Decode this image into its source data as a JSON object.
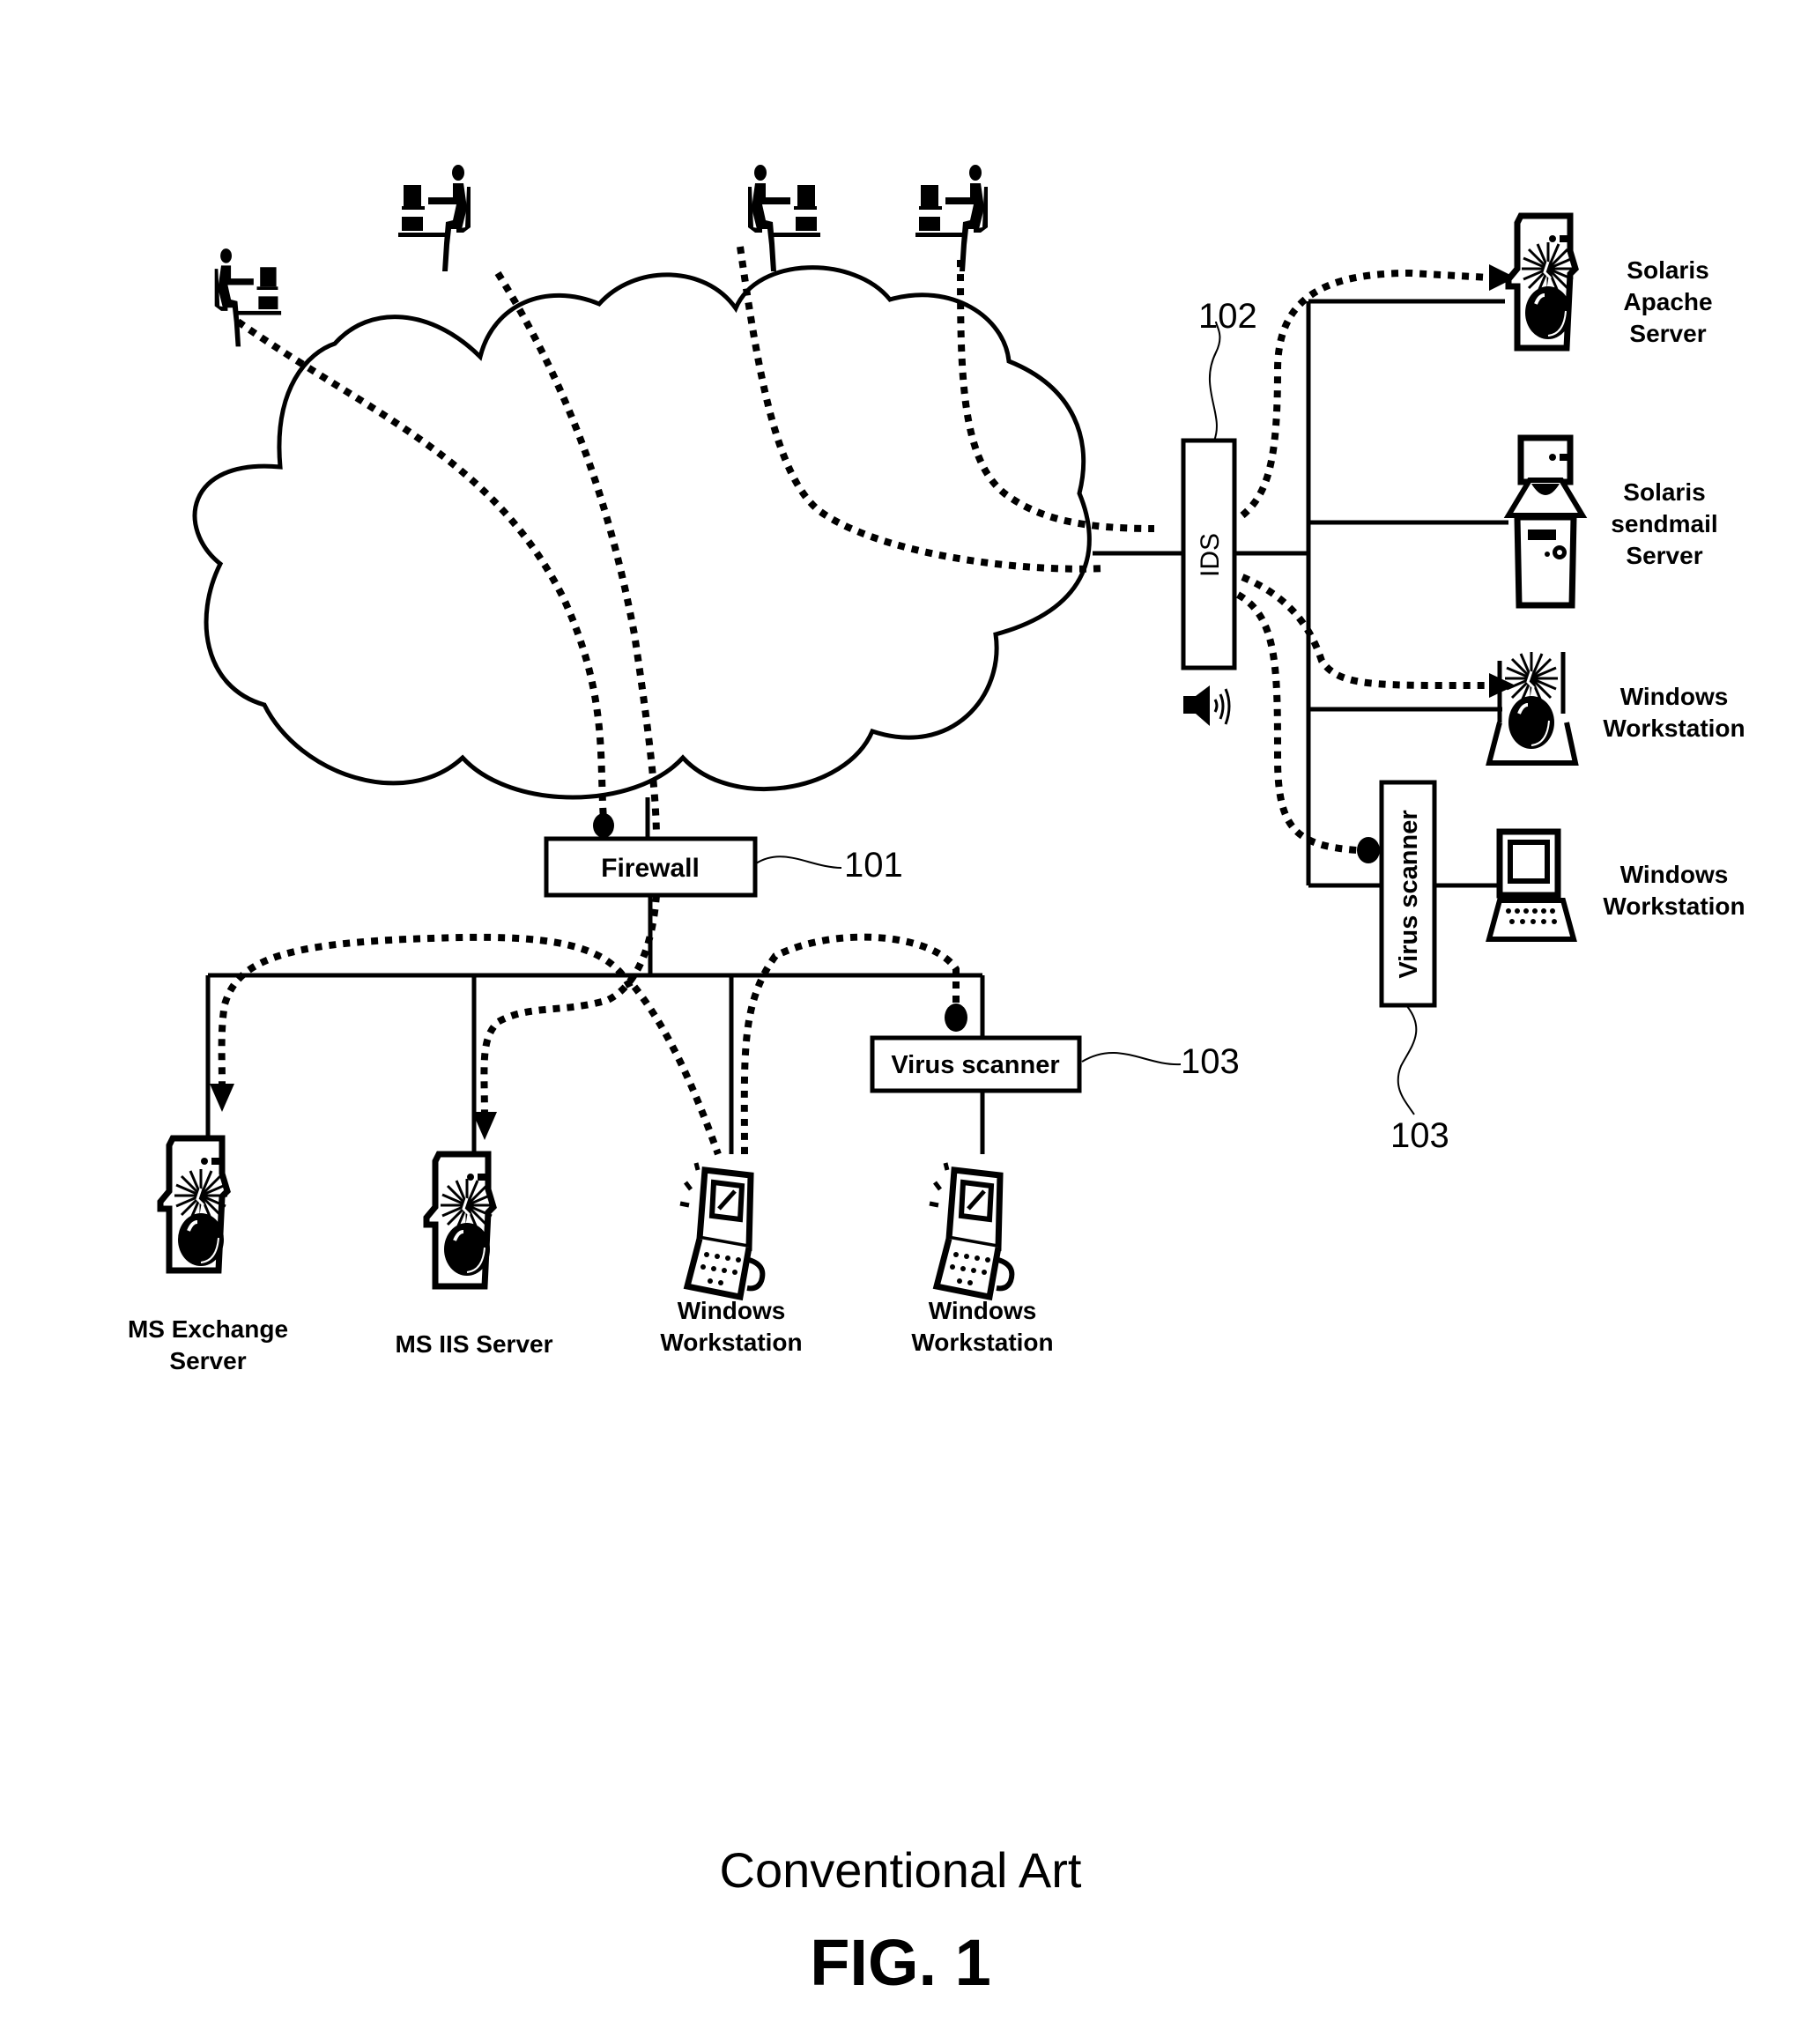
{
  "figure": {
    "caption": "Conventional Art",
    "label": "FIG. 1"
  },
  "network": {
    "cloud_label": "",
    "firewall": {
      "label": "Firewall",
      "ref": "101"
    },
    "ids": {
      "label": "IDS",
      "ref": "102"
    },
    "virus_scanner_lan": {
      "label": "Virus scanner",
      "ref": "103"
    },
    "virus_scanner_dmz": {
      "label": "Virus scanner",
      "ref": "103"
    }
  },
  "users": [
    {
      "id": "user-1",
      "icon": "user-at-computer-icon"
    },
    {
      "id": "user-2",
      "icon": "user-at-computer-icon"
    },
    {
      "id": "user-3",
      "icon": "user-at-computer-icon"
    },
    {
      "id": "user-4",
      "icon": "user-at-computer-icon"
    }
  ],
  "right_nodes": [
    {
      "line1": "Solaris",
      "line2": "Apache",
      "line3": "Server",
      "icon": "server-bomb-icon",
      "compromised": true
    },
    {
      "line1": "Solaris",
      "line2": "sendmail",
      "line3": "Server",
      "icon": "server-shield-icon",
      "compromised": false
    },
    {
      "line1": "Windows",
      "line2": "Workstation",
      "icon": "workstation-bomb-icon",
      "compromised": true
    },
    {
      "line1": "Windows",
      "line2": "Workstation",
      "icon": "desktop-computer-icon",
      "compromised": false
    }
  ],
  "bottom_nodes": [
    {
      "line1": "MS Exchange",
      "line2": "Server",
      "icon": "server-bomb-icon",
      "compromised": true
    },
    {
      "line1": "MS IIS Server",
      "line2": "",
      "icon": "server-bomb-icon",
      "compromised": true
    },
    {
      "line1": "Windows",
      "line2": "Workstation",
      "icon": "laptop-icon",
      "compromised": false
    },
    {
      "line1": "Windows",
      "line2": "Workstation",
      "icon": "laptop-icon",
      "compromised": false
    }
  ],
  "alarm": {
    "icon": "speaker-alarm-icon"
  }
}
